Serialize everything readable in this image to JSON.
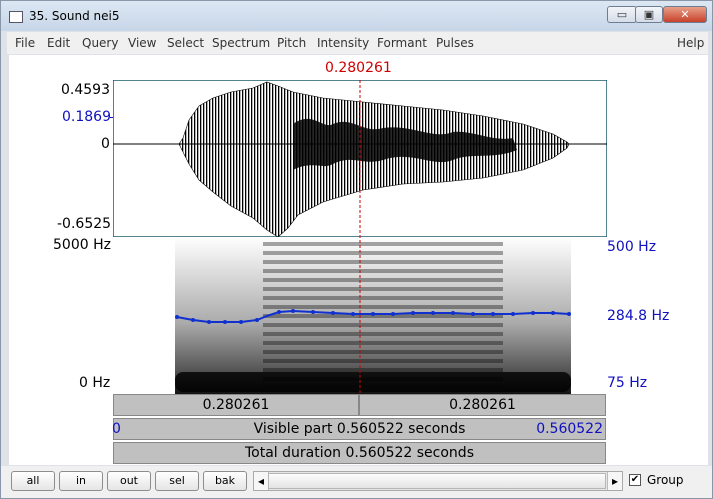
{
  "window": {
    "title": "35. Sound nei5"
  },
  "titlebar_buttons": {
    "minimize": "▭",
    "maximize": "▣",
    "close": "✕"
  },
  "menu": [
    "File",
    "Edit",
    "Query",
    "View",
    "Select",
    "Spectrum",
    "Pitch",
    "Intensity",
    "Formant",
    "Pulses",
    "Help"
  ],
  "cursor": {
    "time": "0.280261"
  },
  "waveform": {
    "ymax": "0.4593",
    "ymark": "0.1869",
    "zero": "0",
    "ymin": "-0.6525"
  },
  "spectrogram": {
    "fmax": "5000 Hz",
    "fmin": "0 Hz"
  },
  "pitch_axis": {
    "max": "500 Hz",
    "mid": "284.8 Hz",
    "min": "75 Hz"
  },
  "selection": {
    "left_duration": "0.280261",
    "right_duration": "0.280261"
  },
  "visible": {
    "start": "0",
    "label": "Visible part 0.560522 seconds",
    "end": "0.560522"
  },
  "total": {
    "label": "Total duration 0.560522 seconds"
  },
  "buttons": {
    "all": "all",
    "in": "in",
    "out": "out",
    "sel": "sel",
    "bak": "bak"
  },
  "scroll": {
    "left": "◂",
    "right": "▸"
  },
  "group": {
    "label": "Group",
    "checked": "✔"
  },
  "colors": {
    "cursor": "#d00000",
    "pitch": "#1030d0",
    "axis_blue": "#1010c0"
  }
}
